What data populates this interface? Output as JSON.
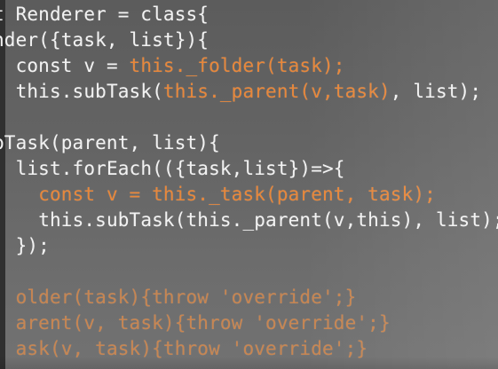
{
  "editor": {
    "theme_colors": {
      "background": "#636363",
      "default_text": "#f2f2f2",
      "highlight_text": "#e8873a"
    },
    "lines": [
      {
        "seg1": "t Renderer = class{"
      },
      {
        "seg1": "nder({task, list}){"
      },
      {
        "seg1": "const v = ",
        "seg2": "this._folder(task);"
      },
      {
        "seg1": "this.subTask(",
        "seg2": "this._parent(v,task)",
        "seg3": ", list);"
      },
      {
        "seg1": ""
      },
      {
        "seg1": "bTask(parent, list){"
      },
      {
        "seg1": "list.forEach(({task,list})=>{"
      },
      {
        "seg1": "const v = this._task(parent, task);"
      },
      {
        "seg1": "this.subTask(this._parent(v,this), list);"
      },
      {
        "seg1": "});"
      },
      {
        "seg1": ""
      },
      {
        "seg1": "older(task){throw 'override';}"
      },
      {
        "seg1": "arent(v, task){throw 'override';}"
      },
      {
        "seg1": "ask(v, task){throw 'override';}"
      }
    ]
  }
}
